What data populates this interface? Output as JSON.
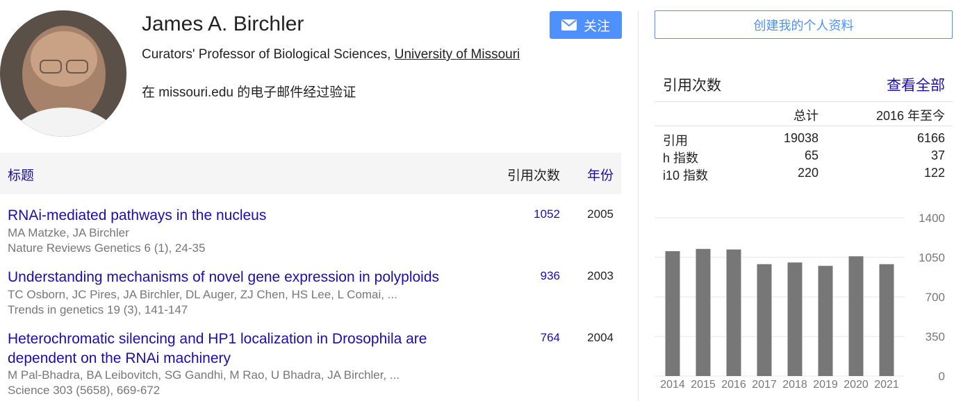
{
  "profile": {
    "name": "James A. Birchler",
    "affiliation_prefix": "Curators' Professor of Biological Sciences, ",
    "affiliation_link": "University of Missouri",
    "email_verified": "在 missouri.edu 的电子邮件经过验证",
    "follow_label": "关注"
  },
  "table": {
    "title_header": "标题",
    "cites_header": "引用次数",
    "year_header": "年份",
    "articles": [
      {
        "title": "RNAi-mediated pathways in the nucleus",
        "authors": "MA Matzke, JA Birchler",
        "venue": "Nature Reviews Genetics 6 (1), 24-35",
        "cites": "1052",
        "year": "2005"
      },
      {
        "title": "Understanding mechanisms of novel gene expression in polyploids",
        "authors": "TC Osborn, JC Pires, JA Birchler, DL Auger, ZJ Chen, HS Lee, L Comai, ...",
        "venue": "Trends in genetics 19 (3), 141-147",
        "cites": "936",
        "year": "2003"
      },
      {
        "title": "Heterochromatic silencing and HP1 localization in Drosophila are dependent on the RNAi machinery",
        "authors": "M Pal-Bhadra, BA Leibovitch, SG Gandhi, M Rao, U Bhadra, JA Birchler, ...",
        "venue": "Science 303 (5658), 669-672",
        "cites": "764",
        "year": "2004"
      }
    ]
  },
  "sidebar": {
    "create_profile_label": "创建我的个人资料",
    "citations_title": "引用次数",
    "view_all_label": "查看全部",
    "col_all": "总计",
    "col_since": "2016 年至今",
    "stats": [
      {
        "label": "引用",
        "all": "19038",
        "since": "6166"
      },
      {
        "label": "h 指数",
        "all": "65",
        "since": "37"
      },
      {
        "label": "i10 指数",
        "all": "220",
        "since": "122"
      }
    ]
  },
  "chart_data": {
    "type": "bar",
    "categories": [
      "2014",
      "2015",
      "2016",
      "2017",
      "2018",
      "2019",
      "2020",
      "2021"
    ],
    "values": [
      1105,
      1125,
      1120,
      990,
      1005,
      975,
      1060,
      990
    ],
    "ylim": [
      0,
      1400
    ],
    "yticks": [
      "1400",
      "1050",
      "700",
      "350",
      "0"
    ],
    "bar_color": "#777777"
  },
  "colors": {
    "link": "#1a0dab",
    "accent": "#4d90fe",
    "muted": "#777777"
  }
}
